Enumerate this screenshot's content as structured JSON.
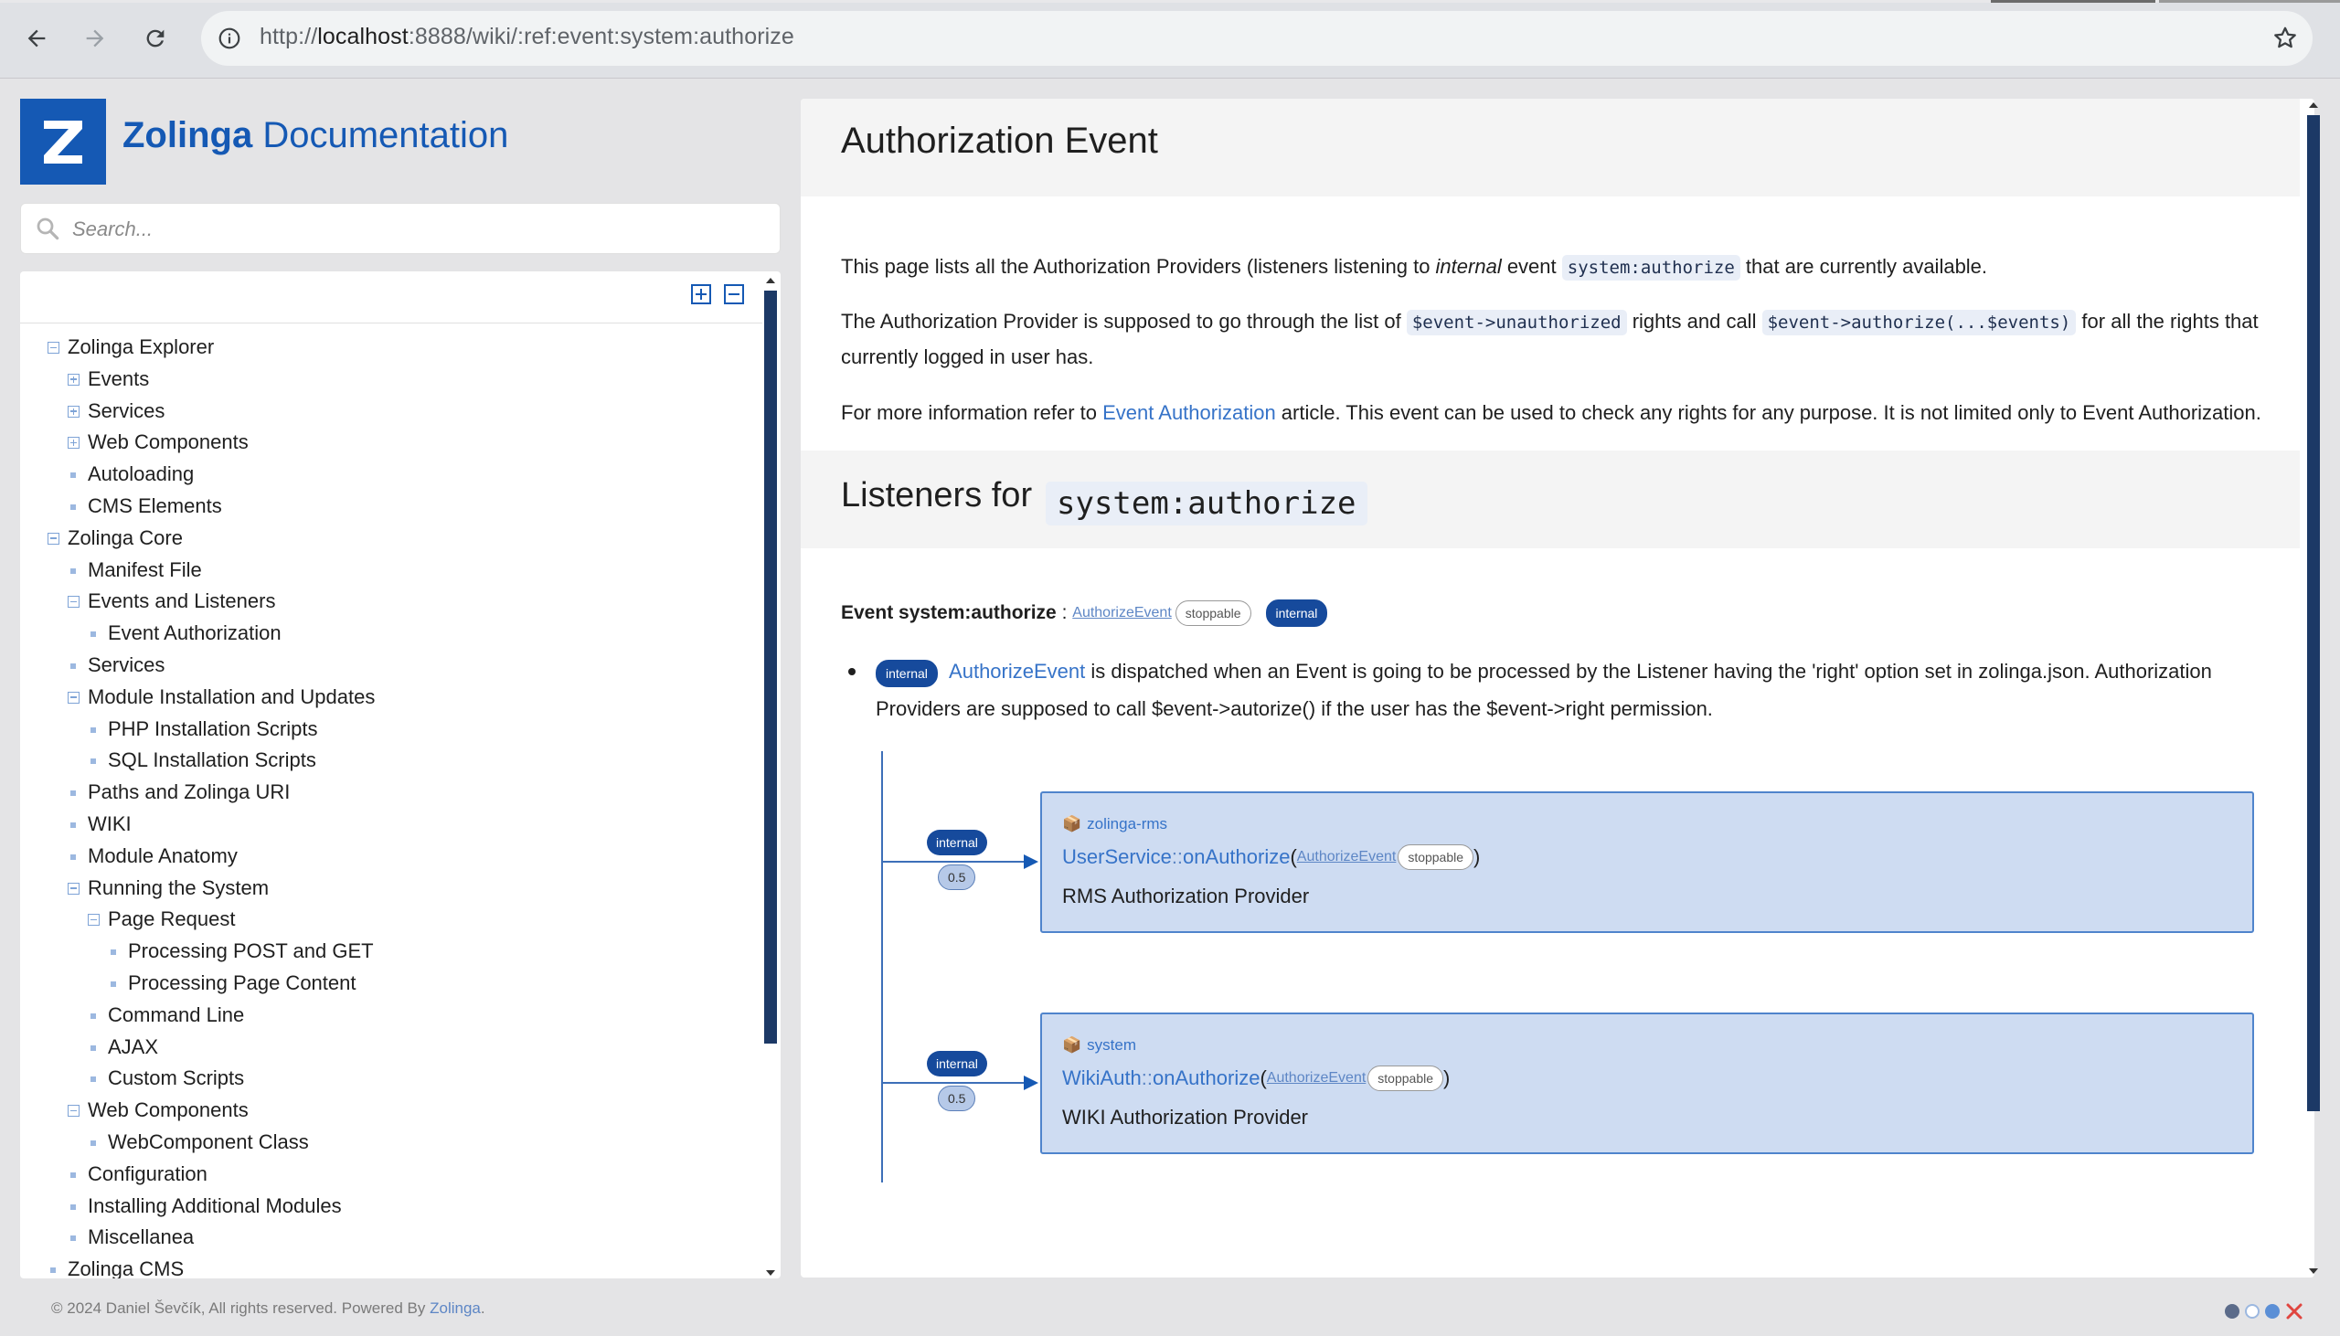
{
  "browser": {
    "url_prefix": "http://",
    "url_host": "localhost",
    "url_rest": ":8888/wiki/:ref:event:system:authorize"
  },
  "sidebar": {
    "logo_letter": "Z",
    "title_bold": "Zolinga",
    "title_rest": " Documentation",
    "search_placeholder": "Search...",
    "tree": [
      {
        "label": "Zolinga Explorer",
        "level": 0,
        "marker": "minus"
      },
      {
        "label": "Events",
        "level": 1,
        "marker": "plus"
      },
      {
        "label": "Services",
        "level": 1,
        "marker": "plus"
      },
      {
        "label": "Web Components",
        "level": 1,
        "marker": "plus"
      },
      {
        "label": "Autoloading",
        "level": 1,
        "marker": "dot"
      },
      {
        "label": "CMS Elements",
        "level": 1,
        "marker": "dot"
      },
      {
        "label": "Zolinga Core",
        "level": 0,
        "marker": "minus"
      },
      {
        "label": "Manifest File",
        "level": 1,
        "marker": "dot"
      },
      {
        "label": "Events and Listeners",
        "level": 1,
        "marker": "minus"
      },
      {
        "label": "Event Authorization",
        "level": 2,
        "marker": "dot"
      },
      {
        "label": "Services",
        "level": 1,
        "marker": "dot"
      },
      {
        "label": "Module Installation and Updates",
        "level": 1,
        "marker": "minus"
      },
      {
        "label": "PHP Installation Scripts",
        "level": 2,
        "marker": "dot"
      },
      {
        "label": "SQL Installation Scripts",
        "level": 2,
        "marker": "dot"
      },
      {
        "label": "Paths and Zolinga URI",
        "level": 1,
        "marker": "dot"
      },
      {
        "label": "WIKI",
        "level": 1,
        "marker": "dot"
      },
      {
        "label": "Module Anatomy",
        "level": 1,
        "marker": "dot"
      },
      {
        "label": "Running the System",
        "level": 1,
        "marker": "minus"
      },
      {
        "label": "Page Request",
        "level": 2,
        "marker": "minus"
      },
      {
        "label": "Processing POST and GET",
        "level": 3,
        "marker": "dot"
      },
      {
        "label": "Processing Page Content",
        "level": 3,
        "marker": "dot"
      },
      {
        "label": "Command Line",
        "level": 2,
        "marker": "dot"
      },
      {
        "label": "AJAX",
        "level": 2,
        "marker": "dot"
      },
      {
        "label": "Custom Scripts",
        "level": 2,
        "marker": "dot"
      },
      {
        "label": "Web Components",
        "level": 1,
        "marker": "minus"
      },
      {
        "label": "WebComponent Class",
        "level": 2,
        "marker": "dot"
      },
      {
        "label": "Configuration",
        "level": 1,
        "marker": "dot"
      },
      {
        "label": "Installing Additional Modules",
        "level": 1,
        "marker": "dot"
      },
      {
        "label": "Miscellanea",
        "level": 1,
        "marker": "dot"
      },
      {
        "label": "Zolinga CMS",
        "level": 0,
        "marker": "dot"
      }
    ]
  },
  "main": {
    "title": "Authorization Event",
    "p1_a": "This page lists all the Authorization Providers (listeners listening to ",
    "p1_em": "internal",
    "p1_b": " event ",
    "p1_code": "system:authorize",
    "p1_c": " that are currently available.",
    "p2_a": "The Authorization Provider is supposed to go through the list of ",
    "p2_code1": "$event->unauthorized",
    "p2_b": " rights and call ",
    "p2_code2": "$event->authorize(...$events)",
    "p2_c": " for all the rights that currently logged in user has.",
    "p3_a": "For more information refer to ",
    "p3_link": "Event Authorization",
    "p3_b": " article. This event can be used to check any rights for any purpose. It is not limited only to Event Authorization.",
    "listeners_title": "Listeners for",
    "listeners_code": "system:authorize",
    "event_label": "Event system:authorize",
    "event_sep": " : ",
    "event_class": "AuthorizeEvent",
    "stoppable": "stoppable",
    "internal": "internal",
    "bullet_link": "AuthorizeEvent",
    "bullet_text": " is dispatched when an Event is going to be processed by the Listener having the 'right' option set in zolinga.json. Authorization Providers are supposed to call $event->autorize() if the user has the $event->right permission.",
    "listeners": [
      {
        "badge": "internal",
        "priority": "0.5",
        "module": "zolinga-rms",
        "class": "UserService",
        "sep": "::",
        "method": "onAuthorize",
        "paren_open": "(",
        "param": "AuthorizeEvent",
        "param_tag": "stoppable",
        "paren_close": ")",
        "description": "RMS Authorization Provider"
      },
      {
        "badge": "internal",
        "priority": "0.5",
        "module": "system",
        "class": "WikiAuth",
        "sep": "::",
        "method": "onAuthorize",
        "paren_open": "(",
        "param": "AuthorizeEvent",
        "param_tag": "stoppable",
        "paren_close": ")",
        "description": "WIKI Authorization Provider"
      }
    ]
  },
  "footer": {
    "text": "© 2024 Daniel Ševčík, All rights reserved. Powered By ",
    "link": "Zolinga",
    "end": "."
  },
  "colors": {
    "accent": "#1559b4",
    "tree_marker": "#7ea3d6",
    "card_bg": "#cedcf2",
    "badge_internal": "#164a9c"
  }
}
